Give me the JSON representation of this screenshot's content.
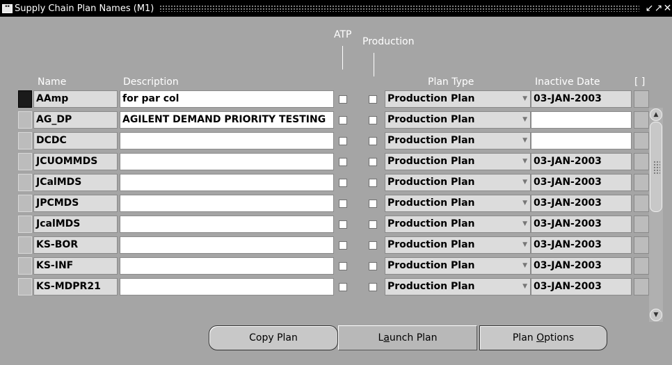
{
  "window": {
    "title": "Supply Chain Plan Names (M1)",
    "app_icon": "oracle-app-icon",
    "controls": [
      "↙",
      "↗",
      "✕"
    ]
  },
  "columns": {
    "atp": "ATP",
    "production": "Production",
    "name": "Name",
    "description": "Description",
    "plan_type": "Plan Type",
    "inactive_date": "Inactive Date",
    "flex": "[ ]"
  },
  "rows": [
    {
      "name": "AAmp",
      "description": "for par col",
      "atp": false,
      "production": false,
      "plan_type": "Production Plan",
      "inactive_date": "03-JAN-2003",
      "current": true
    },
    {
      "name": "AG_DP",
      "description": "AGILENT DEMAND PRIORITY TESTING",
      "atp": false,
      "production": false,
      "plan_type": "Production Plan",
      "inactive_date": "",
      "current": false
    },
    {
      "name": "DCDC",
      "description": "",
      "atp": false,
      "production": false,
      "plan_type": "Production Plan",
      "inactive_date": "",
      "current": false
    },
    {
      "name": "JCUOMMDS",
      "description": "",
      "atp": false,
      "production": false,
      "plan_type": "Production Plan",
      "inactive_date": "03-JAN-2003",
      "current": false
    },
    {
      "name": "JCalMDS",
      "description": "",
      "atp": false,
      "production": false,
      "plan_type": "Production Plan",
      "inactive_date": "03-JAN-2003",
      "current": false
    },
    {
      "name": "JPCMDS",
      "description": "",
      "atp": false,
      "production": false,
      "plan_type": "Production Plan",
      "inactive_date": "03-JAN-2003",
      "current": false
    },
    {
      "name": "JcalMDS",
      "description": "",
      "atp": false,
      "production": false,
      "plan_type": "Production Plan",
      "inactive_date": "03-JAN-2003",
      "current": false
    },
    {
      "name": "KS-BOR",
      "description": "",
      "atp": false,
      "production": false,
      "plan_type": "Production Plan",
      "inactive_date": "03-JAN-2003",
      "current": false
    },
    {
      "name": "KS-INF",
      "description": "",
      "atp": false,
      "production": false,
      "plan_type": "Production Plan",
      "inactive_date": "03-JAN-2003",
      "current": false
    },
    {
      "name": "KS-MDPR21",
      "description": "",
      "atp": false,
      "production": false,
      "plan_type": "Production Plan",
      "inactive_date": "03-JAN-2003",
      "current": false
    }
  ],
  "buttons": {
    "copy_plan": "Copy Plan",
    "launch_plan": {
      "pre": "L",
      "ul": "a",
      "post": "unch Plan"
    },
    "plan_options": {
      "pre": "Plan ",
      "ul": "O",
      "post": "ptions"
    }
  },
  "colors": {
    "background": "#a5a5a5",
    "titlebar": "#000000",
    "field_white": "#ffffff",
    "field_gray": "#dcdcdc"
  }
}
